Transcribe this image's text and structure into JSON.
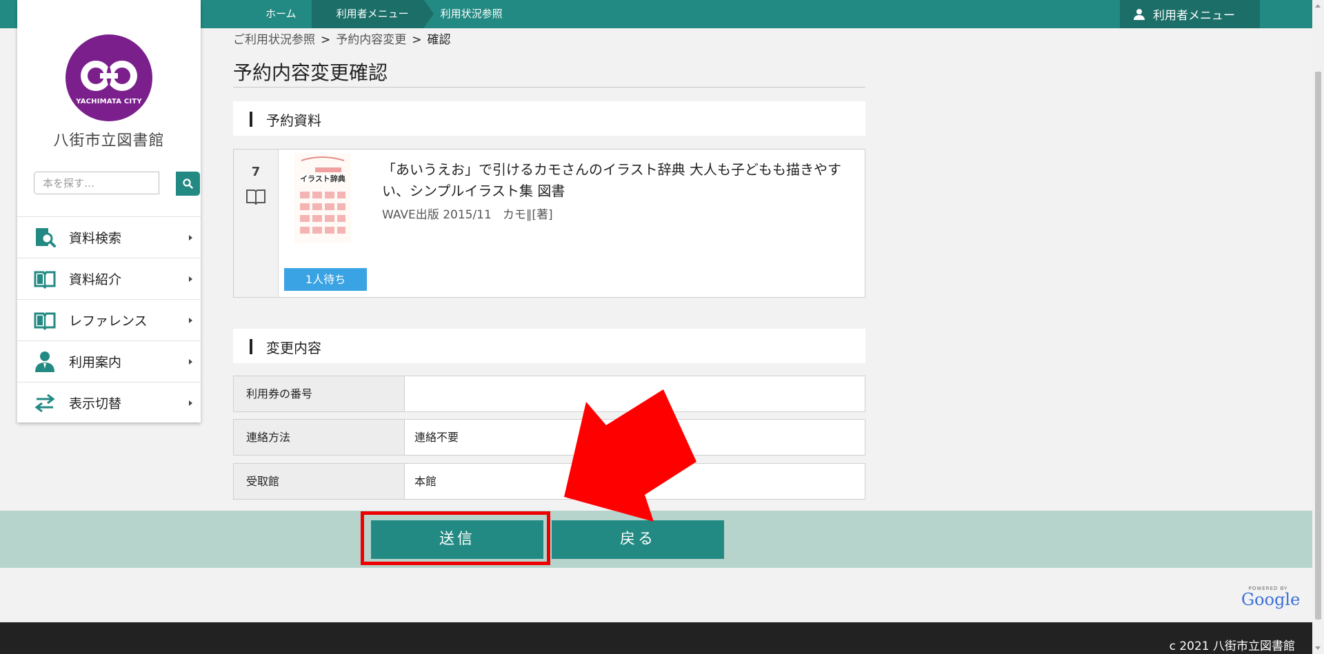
{
  "topbar": {
    "crumbs": [
      "ホーム",
      "利用者メニュー",
      "利用状況参照"
    ],
    "user_menu": "利用者メニュー"
  },
  "sidebar": {
    "logo_text": "YACHIMATA CITY",
    "library_name": "八街市立図書館",
    "search_placeholder": "本を探す…",
    "items": [
      {
        "label": "資料検索",
        "icon": "book-search-icon"
      },
      {
        "label": "資料紹介",
        "icon": "open-book-icon"
      },
      {
        "label": "レファレンス",
        "icon": "open-book-icon"
      },
      {
        "label": "利用案内",
        "icon": "person-icon"
      },
      {
        "label": "表示切替",
        "icon": "switch-arrows-icon"
      }
    ]
  },
  "breadcrumb": {
    "items": [
      "ご利用状況参照",
      "予約内容変更",
      "確認"
    ],
    "separator": ">"
  },
  "page_title": "予約内容変更確認",
  "reserved_section": {
    "heading": "予約資料",
    "book": {
      "number": "7",
      "title": "「あいうえお」で引けるカモさんのイラスト辞典 大人も子どもも描きやすい、シンプルイラスト集 図書",
      "publisher_date": "WAVE出版 2015/11",
      "author": "カモ∥[著]",
      "status": "1人待ち",
      "cover_text": "イラスト辞典"
    }
  },
  "change_section": {
    "heading": "変更内容",
    "rows": [
      {
        "label": "利用券の番号",
        "value": ""
      },
      {
        "label": "連絡方法",
        "value": "連絡不要"
      },
      {
        "label": "受取館",
        "value": "本館"
      }
    ]
  },
  "buttons": {
    "send": "送信",
    "back": "戻る"
  },
  "powered_by": {
    "small": "POWERED BY",
    "brand": "Google"
  },
  "footer": {
    "copyright": "c 2021 八街市立図書館"
  },
  "colors": {
    "teal": "#228a82",
    "teal_dark": "#1b6f68",
    "band": "#b6d3cc",
    "status_blue": "#3aa3e3",
    "highlight_red": "#ee0000",
    "logo_purple": "#7a1f8c"
  }
}
